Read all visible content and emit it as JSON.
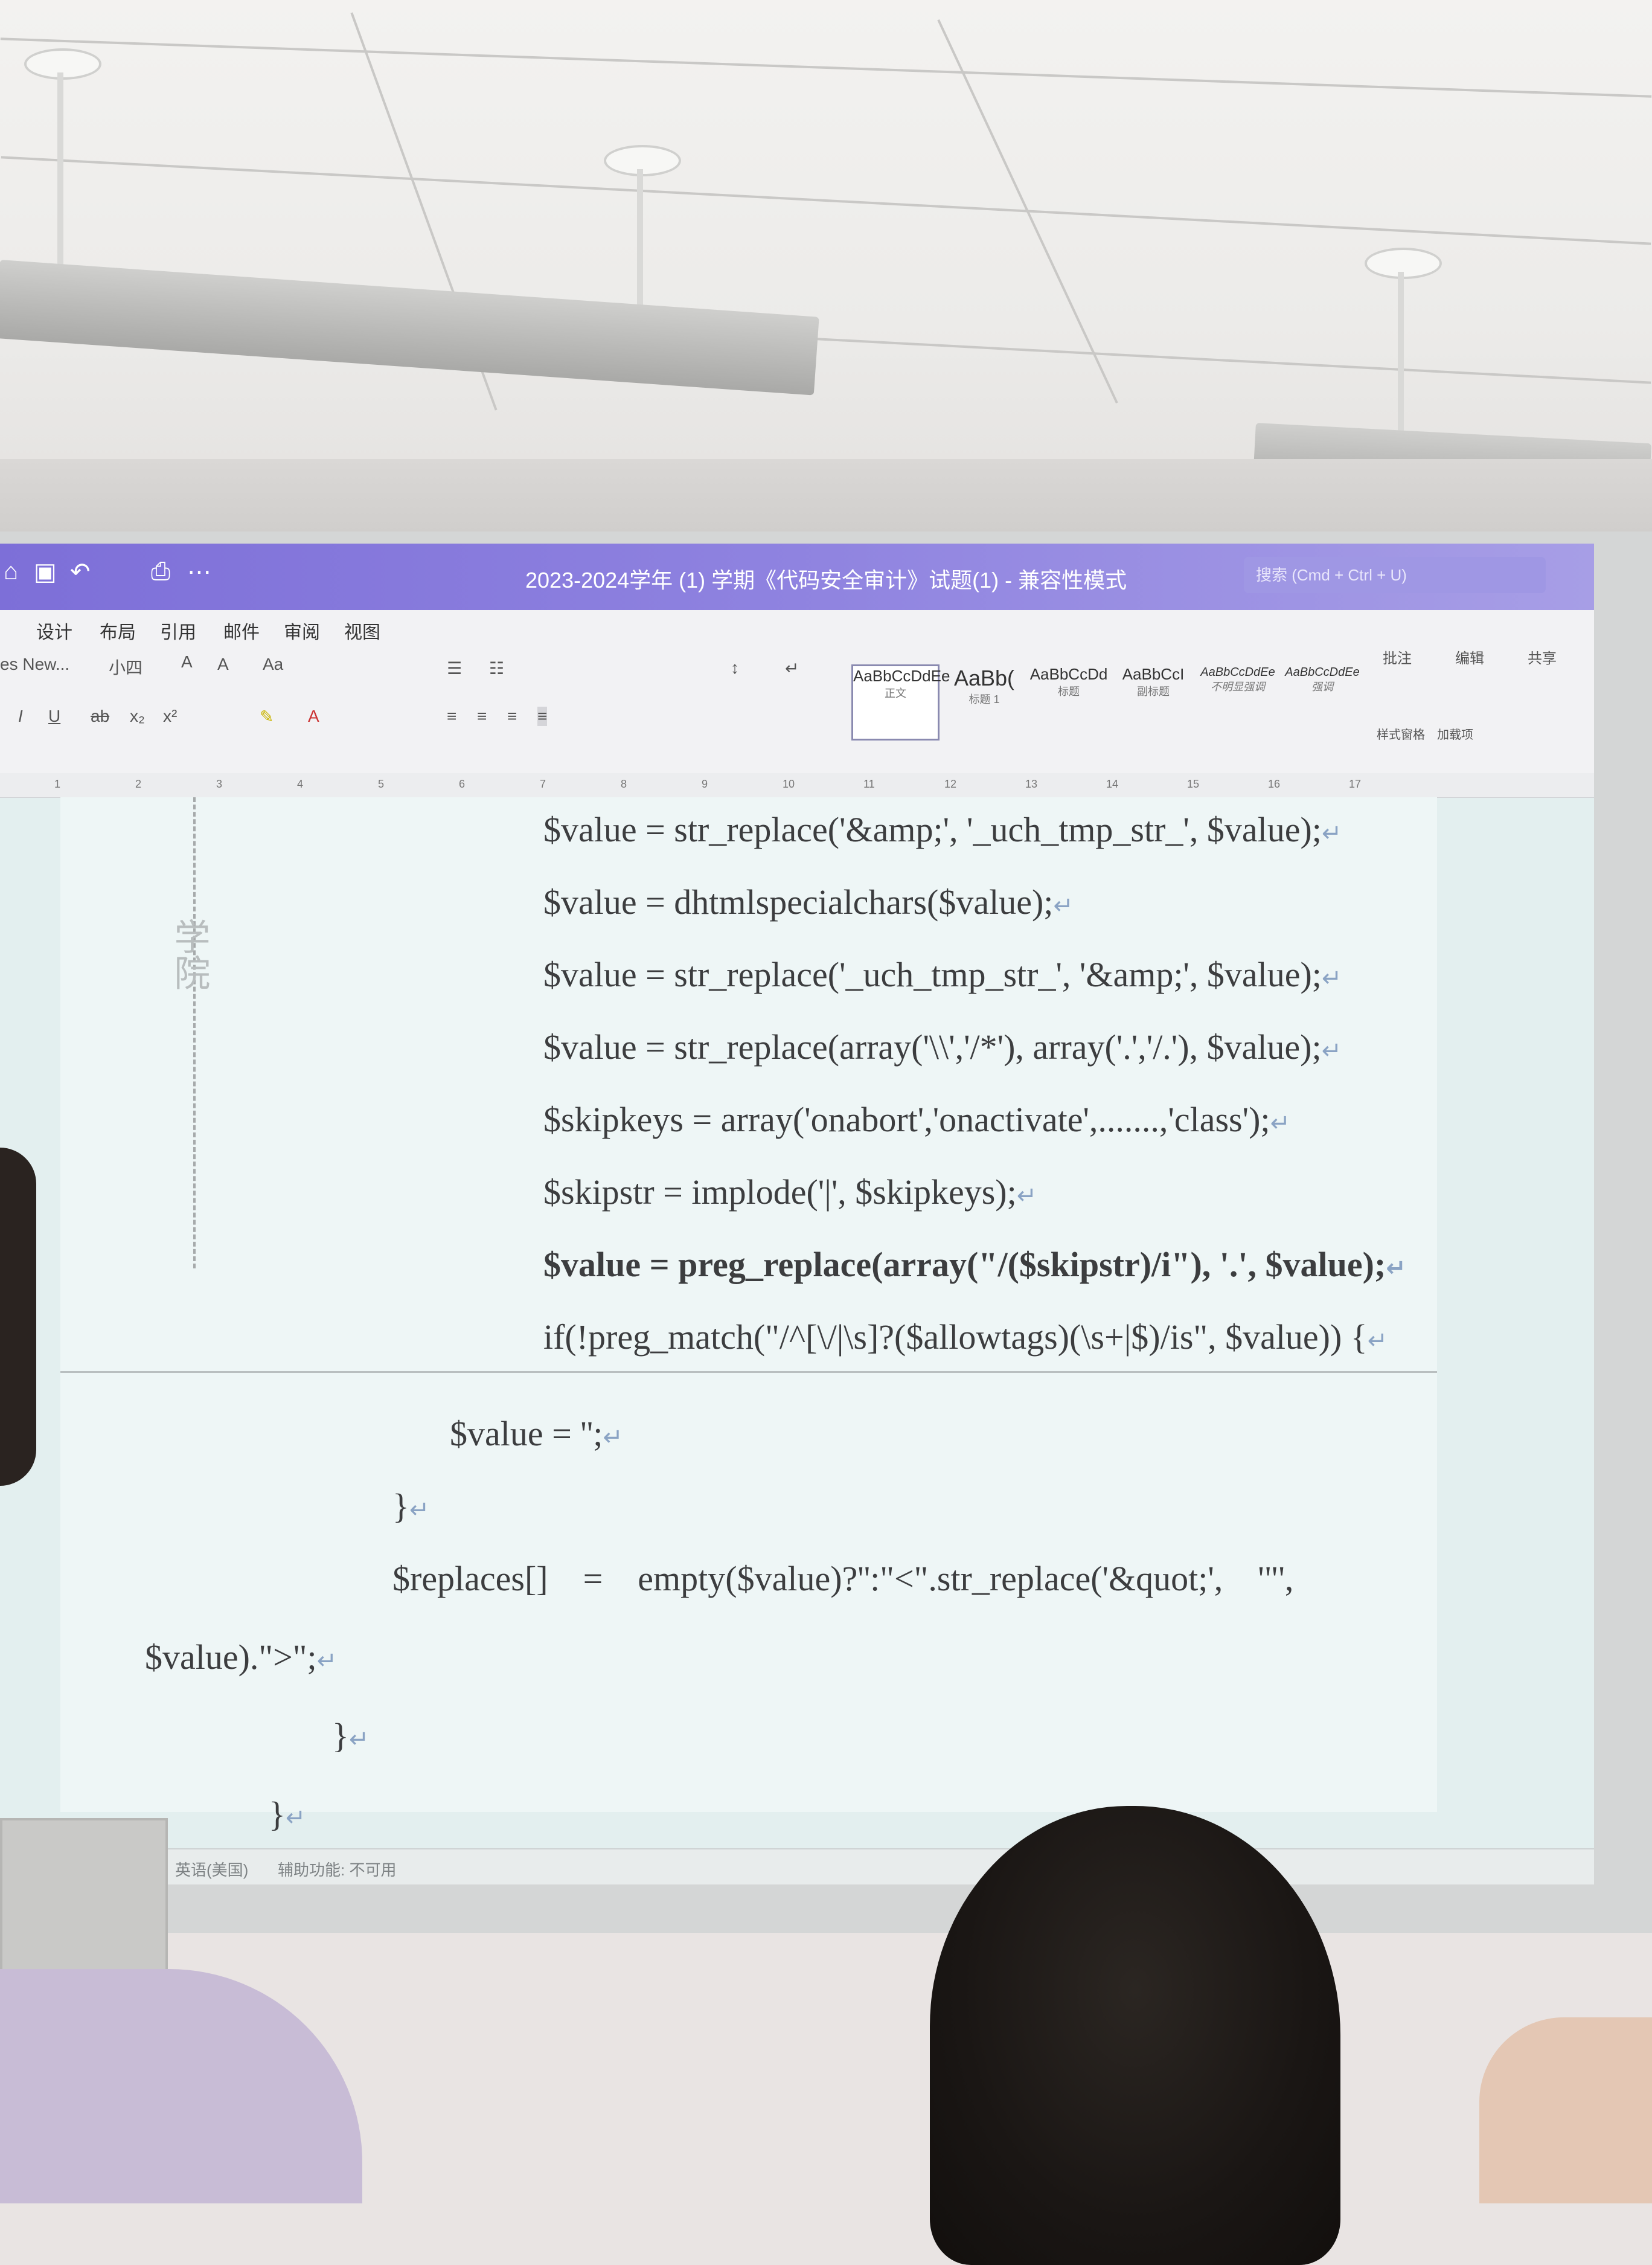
{
  "window": {
    "title": "2023-2024学年 (1) 学期《代码安全审计》试题(1) - 兼容性模式",
    "search_placeholder": "搜索 (Cmd + Ctrl + U)"
  },
  "tabs": [
    "设计",
    "布局",
    "引用",
    "邮件",
    "审阅",
    "视图"
  ],
  "ribbon": {
    "font_name": "es New...",
    "font_size": "小四",
    "font_size_up": "A",
    "font_size_down": "A",
    "change_case": "Aa",
    "comment": "批注",
    "edit": "编辑",
    "share": "共享",
    "styles": [
      {
        "preview": "AaBbCcDdEe",
        "name": "正文"
      },
      {
        "preview": "AaBb(",
        "name": "标题 1"
      },
      {
        "preview": "AaBbCcDd",
        "name": "标题"
      },
      {
        "preview": "AaBbCcI",
        "name": "副标题"
      },
      {
        "preview": "AaBbCcDdEe",
        "name": "不明显强调"
      },
      {
        "preview": "AaBbCcDdEe",
        "name": "强调"
      }
    ],
    "styles_pane": "样式窗格",
    "addins": "加载项"
  },
  "ruler_ticks": [
    "1",
    "2",
    "3",
    "4",
    "5",
    "6",
    "7",
    "8",
    "9",
    "10",
    "11",
    "12",
    "13",
    "14",
    "15",
    "16",
    "17"
  ],
  "sidebar_label": "学院",
  "code_lines": [
    "$value = str_replace('&amp;', '_uch_tmp_str_', $value);",
    "$value = dhtmlspecialchars($value);",
    "$value = str_replace('_uch_tmp_str_', '&amp;', $value);",
    "$value = str_replace(array('\\\\','/*'), array('.','/.'), $value);",
    "$skipkeys = array('onabort','onactivate',.......,'class');",
    "$skipstr = implode('|', $skipkeys);",
    "$value = preg_replace(array(\"/($skipstr)/i\"), '.', $value);",
    "if(!preg_match(\"/^[\\/|\\s]?($allowtags)(\\s+|$)/is\", $value)) {",
    "$value = '';",
    "}",
    "$replaces[]    =    empty($value)?'':\"<\".str_replace('&quot;',    '\"',",
    "$value).\">\";",
    "}",
    "}"
  ],
  "statusbar": {
    "language": "英语(美国)",
    "accessibility": "辅助功能: 不可用"
  }
}
